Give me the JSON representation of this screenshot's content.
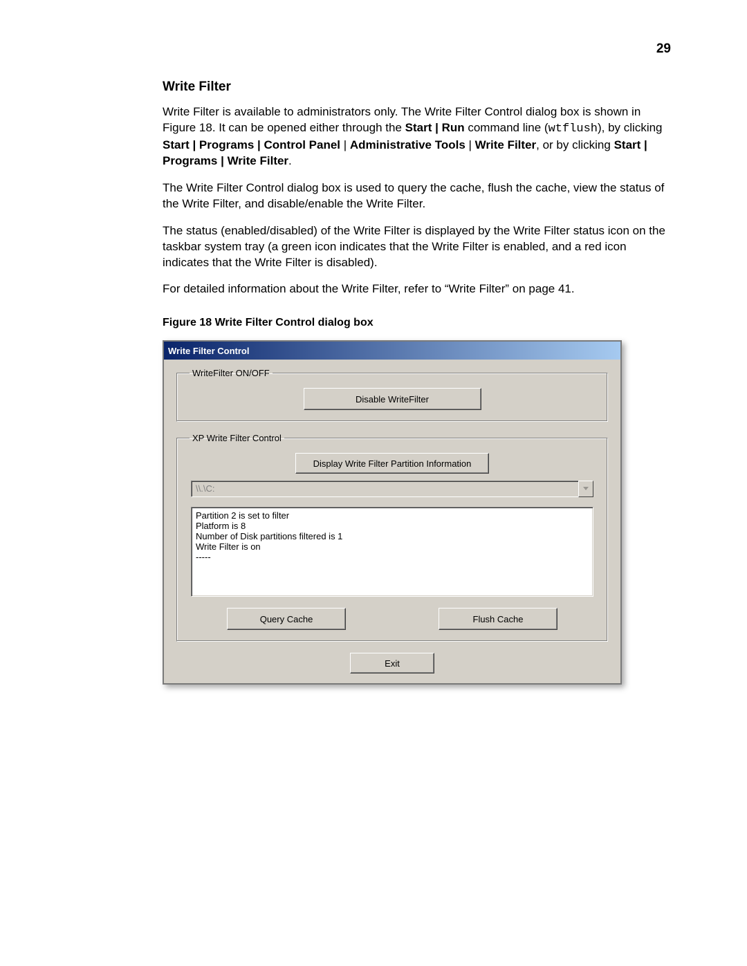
{
  "page": {
    "number": "29",
    "heading": "Write Filter",
    "para1_a": "Write Filter is available to administrators only. The Write Filter Control dialog box is shown in Figure 18. It can be opened either through the ",
    "para1_b": "Start | Run",
    "para1_c": " command line (",
    "para1_code": "wtflush",
    "para1_d": "), by clicking ",
    "para1_e": "Start | Programs | Control Panel",
    "para1_f": " | ",
    "para1_g": "Administrative Tools",
    "para1_h": " | ",
    "para1_i": "Write Filter",
    "para1_j": ", or by clicking ",
    "para1_k": "Start | Programs | Write Filter",
    "para1_l": ".",
    "para2": "The Write Filter Control dialog box is used to query the cache, flush the cache, view the status of the Write Filter, and disable/enable the Write Filter.",
    "para3": "The status (enabled/disabled) of the Write Filter is displayed by the Write Filter status icon on the taskbar system tray (a green icon indicates that the Write Filter is enabled, and a red icon indicates that the Write Filter is disabled).",
    "para4": "For detailed information about the Write Filter, refer to “Write Filter” on page 41.",
    "figcaption": "Figure 18    Write Filter Control dialog box"
  },
  "dialog": {
    "title": "Write Filter Control",
    "group1": {
      "legend": "WriteFilter ON/OFF",
      "disable_label": "Disable WriteFilter"
    },
    "group2": {
      "legend": "XP Write Filter Control",
      "display_label": "Display Write Filter Partition Information",
      "combo_text": "\\\\.\\C:",
      "textarea": "Partition 2 is set to filter\nPlatform is 8\nNumber of Disk partitions filtered is 1\nWrite Filter is on\n-----",
      "query_label": "Query Cache",
      "flush_label": "Flush Cache"
    },
    "exit_label": "Exit"
  }
}
